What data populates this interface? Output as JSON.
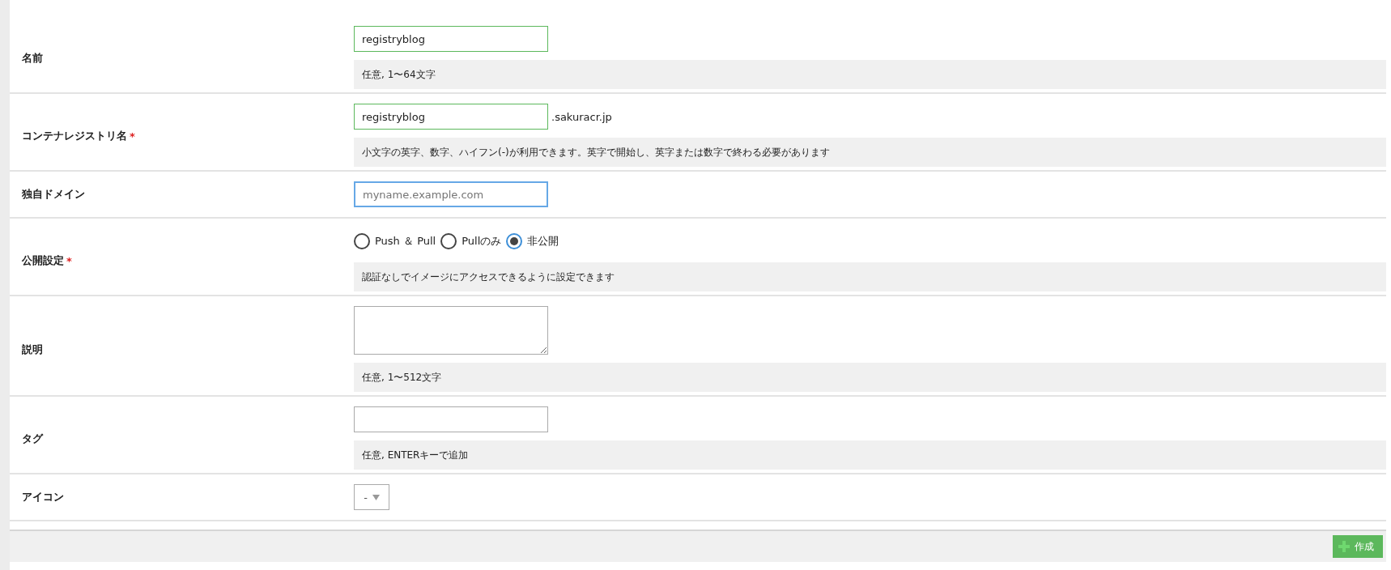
{
  "fields": [
    {
      "label": "名前",
      "kind": "text",
      "value": "registryblog",
      "valid": true,
      "focused": false,
      "hint": "任意, 1〜64文字"
    },
    {
      "label": "コンテナレジストリ名",
      "required_mark": "*",
      "kind": "text",
      "value": "registryblog",
      "valid": true,
      "focused": false,
      "suffix": ".sakuracr.jp",
      "hint": "小文字の英字、数字、ハイフン(-)が利用できます。英字で開始し、英字または数字で終わる必要があります"
    },
    {
      "label": "独自ドメイン",
      "kind": "text",
      "placeholder": "myname.example.com",
      "valid": false,
      "focused": true
    },
    {
      "label": "公開設定",
      "required_mark": "*",
      "kind": "radio",
      "options": [
        {
          "label": "Push ＆ Pull",
          "selected": false
        },
        {
          "label": "Pullのみ",
          "selected": false
        },
        {
          "label": "非公開",
          "selected": true
        }
      ],
      "hint": "認証なしでイメージにアクセスできるように設定できます"
    },
    {
      "label": "説明",
      "kind": "textarea",
      "valid": false,
      "focused": false,
      "hint": "任意, 1〜512文字"
    },
    {
      "label": "タグ",
      "kind": "text",
      "valid": false,
      "focused": false,
      "hint": "任意, ENTERキーで追加"
    },
    {
      "label": "アイコン",
      "kind": "select",
      "value": "-"
    }
  ],
  "footer": {
    "button": "作成"
  }
}
